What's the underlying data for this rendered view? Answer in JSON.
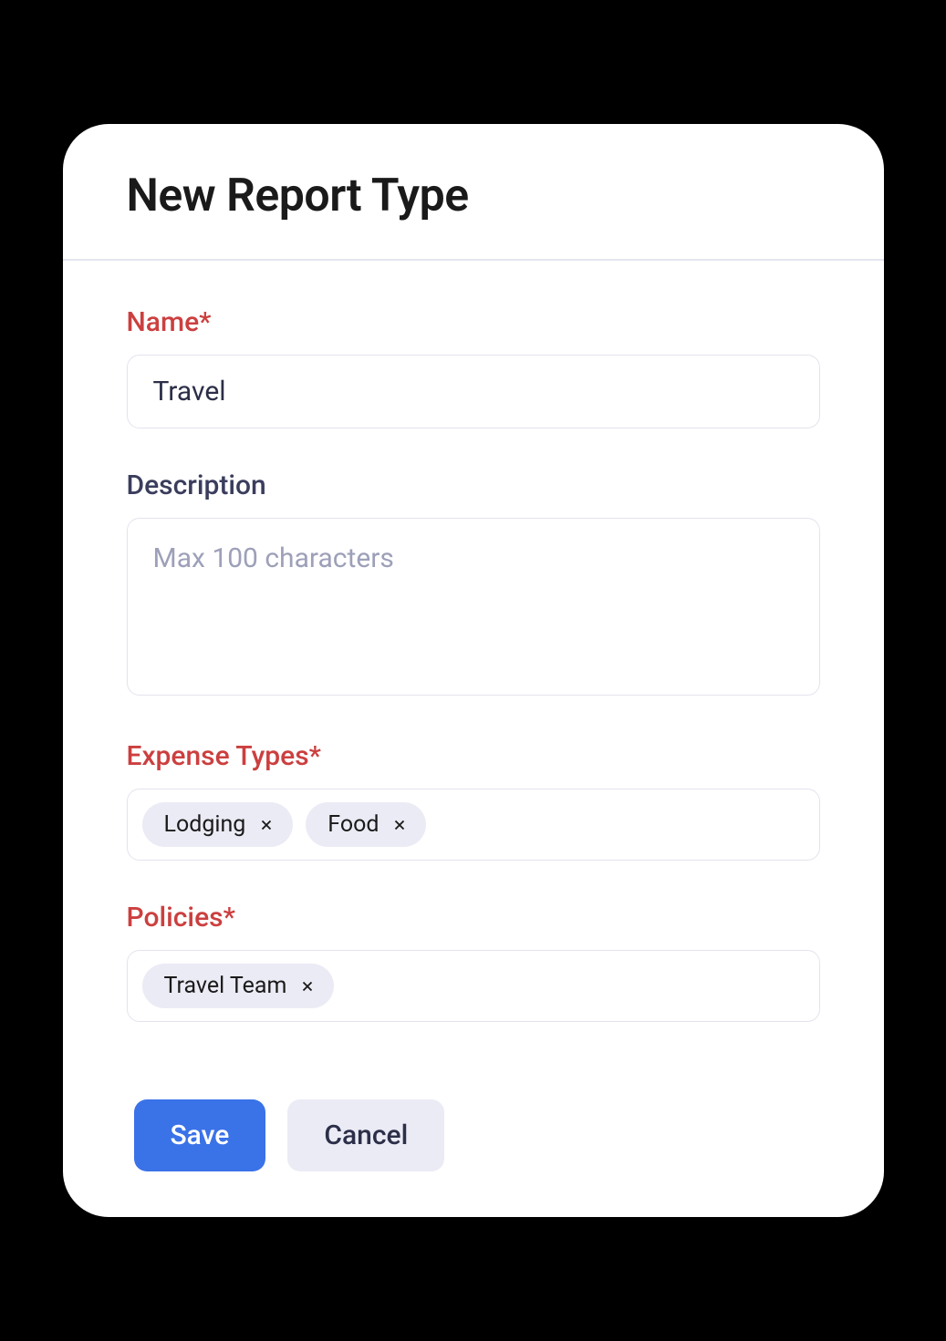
{
  "modal": {
    "title": "New Report Type"
  },
  "fields": {
    "name": {
      "label": "Name*",
      "value": "Travel"
    },
    "description": {
      "label": "Description",
      "placeholder": "Max 100 characters",
      "value": ""
    },
    "expenseTypes": {
      "label": "Expense Types*",
      "tags": [
        "Lodging",
        "Food"
      ]
    },
    "policies": {
      "label": "Policies*",
      "tags": [
        "Travel Team"
      ]
    }
  },
  "actions": {
    "save": "Save",
    "cancel": "Cancel"
  }
}
